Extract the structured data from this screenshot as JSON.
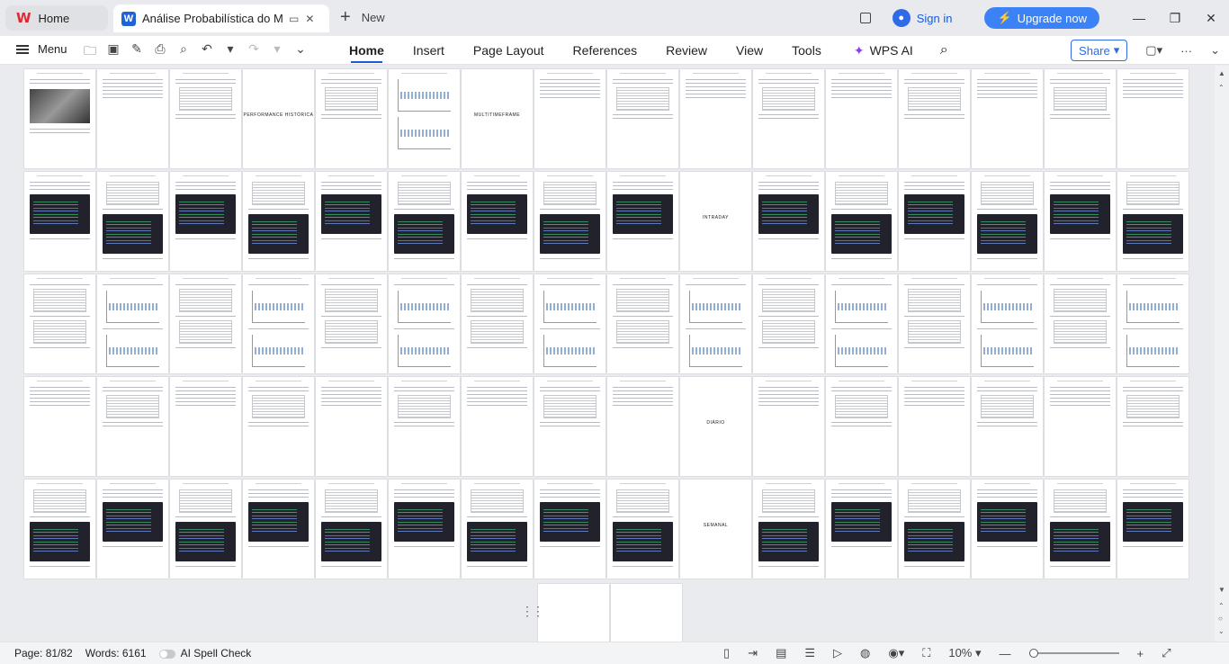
{
  "tabs": {
    "home_label": "Home",
    "doc_title": "Análise Probabilística do Mini",
    "new_tab_label": "New"
  },
  "account": {
    "sign_in": "Sign in",
    "upgrade": "Upgrade now"
  },
  "ribbon": {
    "menu_label": "Menu",
    "tabs": [
      "Home",
      "Insert",
      "Page Layout",
      "References",
      "Review",
      "View",
      "Tools"
    ],
    "active_tab": "Home",
    "wps_ai": "WPS AI",
    "share": "Share"
  },
  "document": {
    "section_titles": [
      "PERFORMANCE HISTÓRICA",
      "MULTITIMEFRAME",
      "INTRADAY",
      "DIÁRIO",
      "SEMANAL"
    ],
    "page_count": 82
  },
  "status": {
    "page": "Page: 81/82",
    "words": "Words: 6161",
    "spell_check": "AI Spell Check",
    "zoom": "10%"
  },
  "colors": {
    "accent": "#1a5bd6",
    "upgrade_bg": "#3b82f6",
    "wps_red": "#e0282e",
    "code_bg": "#22222c"
  }
}
